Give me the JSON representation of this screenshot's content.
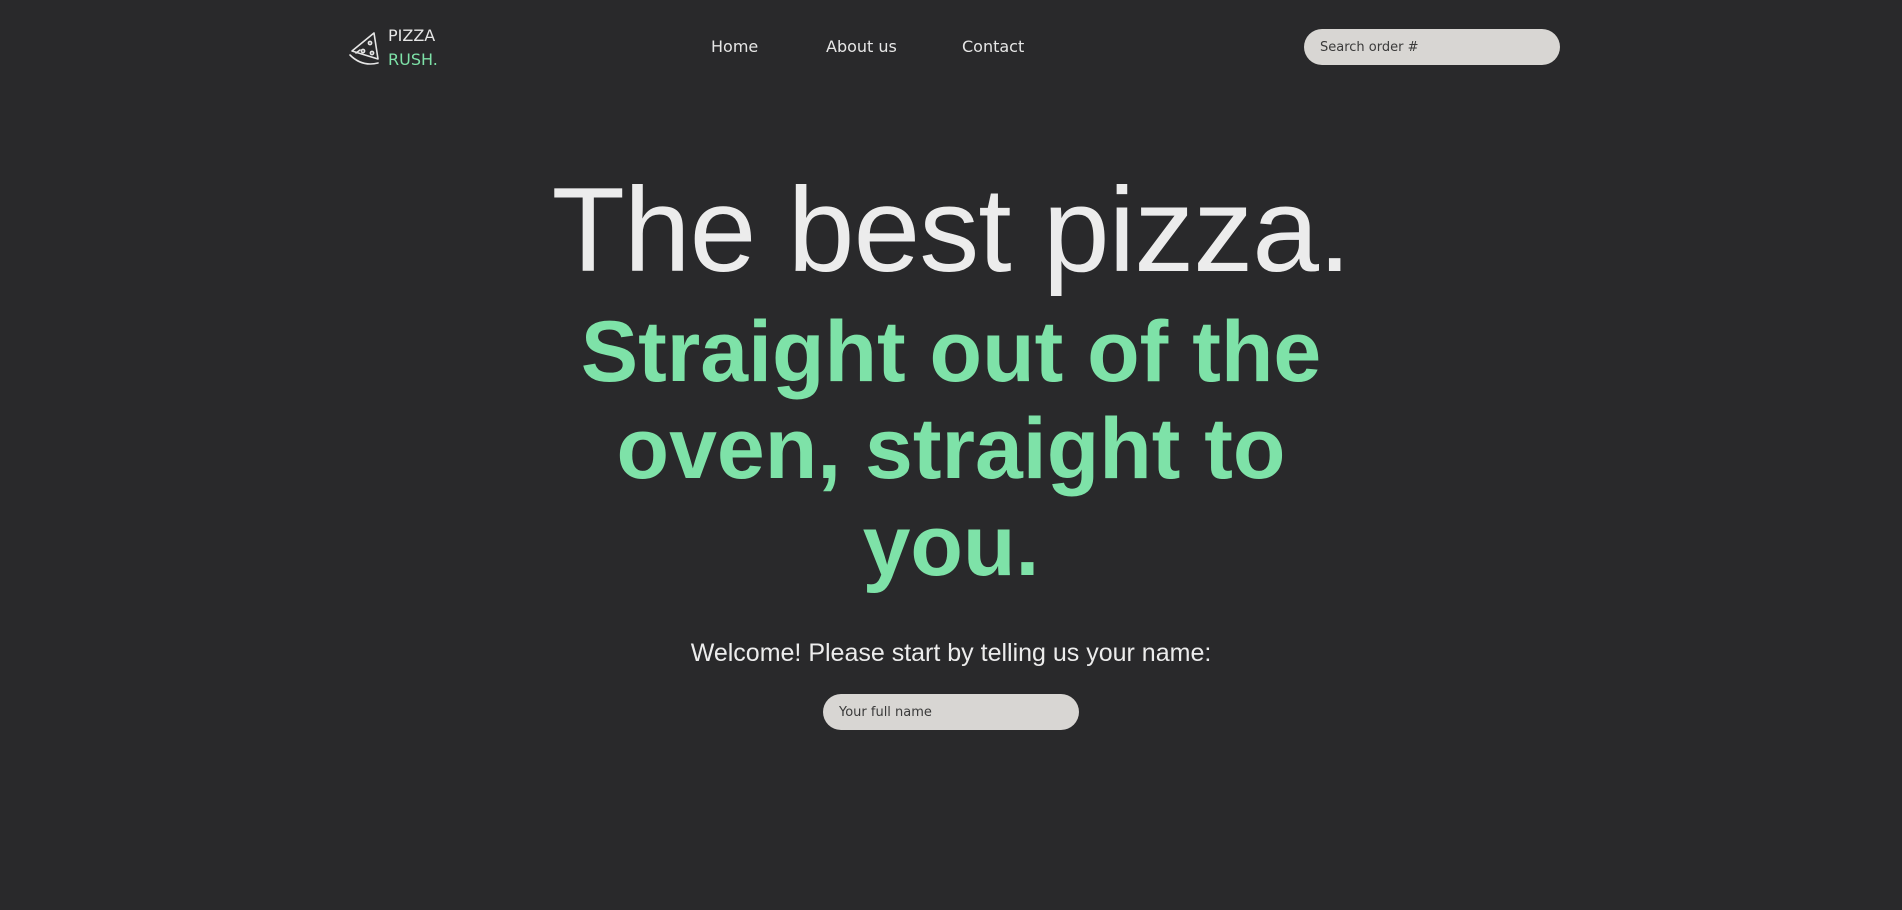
{
  "brand": {
    "line1": "PIZZA",
    "line2": "RUSH.",
    "icon": "pizza-slice-icon",
    "accent_color": "#7ee2a8"
  },
  "nav": {
    "items": [
      {
        "label": "Home"
      },
      {
        "label": "About us"
      },
      {
        "label": "Contact"
      }
    ]
  },
  "search": {
    "placeholder": "Search order #",
    "value": ""
  },
  "hero": {
    "headline": "The best pizza.",
    "subheadline": "Straight out of the oven, straight to you.",
    "welcome": "Welcome! Please start by telling us your name:",
    "name_input": {
      "placeholder": "Your full name",
      "value": ""
    }
  },
  "colors": {
    "background": "#29292b",
    "text": "#ececec",
    "accent": "#7ee2a8",
    "input_bg": "#d8d6d3"
  }
}
